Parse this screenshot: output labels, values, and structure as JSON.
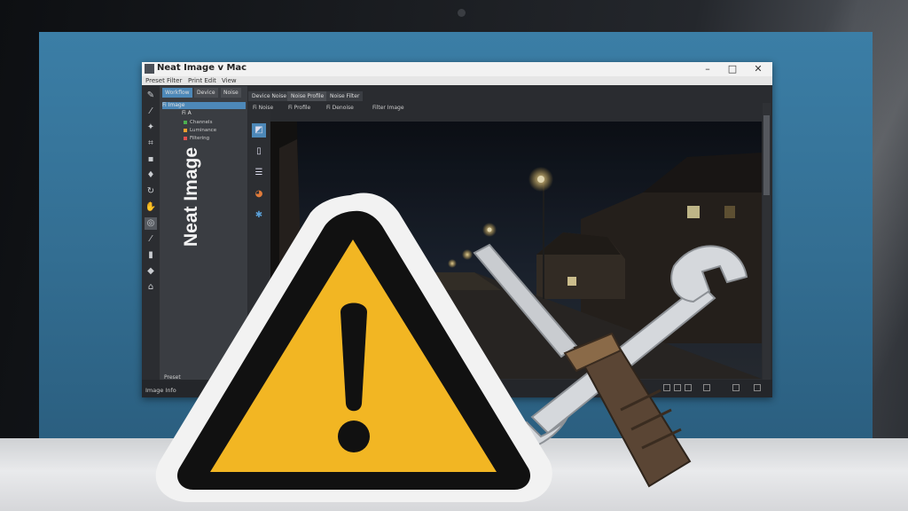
{
  "window": {
    "title": "Neat Image v Mac",
    "minimize": "–",
    "maximize": "□",
    "close": "✕"
  },
  "menu": [
    "Preset",
    "Filter",
    "Print Edit",
    "View"
  ],
  "side_logo_text": "Neat Image",
  "left_panel": {
    "tabs": [
      "Workflow",
      "Device",
      "Noise"
    ],
    "tree": [
      {
        "label": "Fi  Image",
        "selected": true
      },
      {
        "label": "Fi  A",
        "selected": false
      }
    ],
    "layers": [
      {
        "label": "Channels",
        "color": "#4caf50"
      },
      {
        "label": "Luminance",
        "color": "#f0a030"
      },
      {
        "label": "Filtering",
        "color": "#e05050"
      }
    ],
    "footer": "Preset"
  },
  "doc_tabs": [
    "Device Noise",
    "Noise Profile",
    "Noise Filter"
  ],
  "subbar": [
    "Fi  Noise",
    "Fi  Profile",
    "Fi  Denoise",
    "Filter Image"
  ],
  "status": {
    "text": "Image Info"
  },
  "icons": {
    "toolbar": [
      "pen-icon",
      "brush-icon",
      "wand-icon",
      "crop-icon",
      "eraser-icon",
      "stamp-icon",
      "rotate-icon",
      "hand-icon",
      "zoom-icon",
      "dropper-icon",
      "fill-icon",
      "shape-icon",
      "home-icon"
    ],
    "mid": [
      "app-icon",
      "document-icon",
      "list-icon",
      "palette-icon",
      "settings-icon"
    ]
  },
  "colors": {
    "accent": "#4d88b8",
    "warning_yellow": "#f2b623",
    "screen_blue": "#3b7ea6"
  }
}
